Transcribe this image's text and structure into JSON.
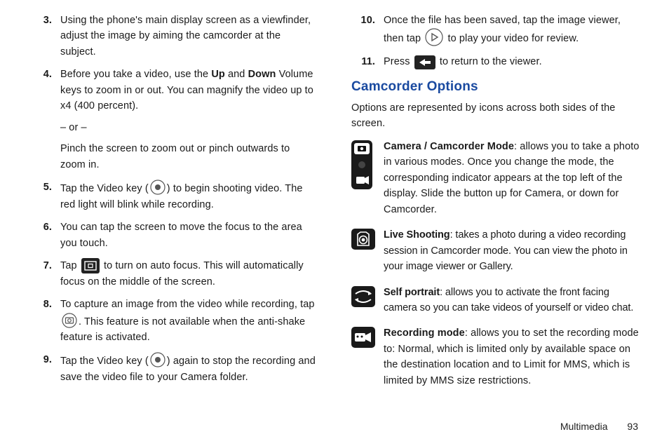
{
  "left": {
    "steps": [
      {
        "n": "3.",
        "text": "Using the phone's main display screen as a viewfinder, adjust the image by aiming the camcorder at the subject."
      },
      {
        "n": "4.",
        "pre": "Before you take a video, use the ",
        "b1": "Up",
        "mid1": " and ",
        "b2": "Down",
        "post1": " Volume keys to zoom in or out. You can magnify the video up to x4 (400 percent).",
        "sub1": "– or –",
        "sub2": "Pinch the screen to zoom out or pinch outwards to zoom in."
      },
      {
        "n": "5.",
        "pre": "Tap the Video key (",
        "post": ") to begin shooting video. The red light will blink while recording."
      },
      {
        "n": "6.",
        "text": "You can tap the screen to move the focus to the area you touch."
      },
      {
        "n": "7.",
        "pre": "Tap ",
        "post": " to turn on auto focus. This will automatically focus on the middle of the screen."
      },
      {
        "n": "8.",
        "pre": "To capture an image from the video while recording, tap ",
        "post": ". This feature is not available when the anti-shake feature is activated."
      },
      {
        "n": "9.",
        "pre": "Tap the Video key (",
        "post": ") again to stop the recording and save the video file to your Camera folder."
      }
    ]
  },
  "right": {
    "steps": [
      {
        "n": "10.",
        "pre": "Once the file has been saved, tap the image viewer, then tap ",
        "post": " to play your video for review."
      },
      {
        "n": "11.",
        "pre": "Press ",
        "post": " to return to the viewer."
      }
    ],
    "heading": "Camcorder Options",
    "intro": "Options are represented by icons across both sides of the screen.",
    "options": [
      {
        "title": "Camera / Camcorder Mode",
        "text": ": allows you to take a photo in various modes. Once you change the mode, the corresponding indicator appears at the top left of the display. Slide the button up for Camera, or down for Camcorder."
      },
      {
        "title": "Live Shooting",
        "text": ": takes a photo during a video recording session in Camcorder mode. You can view the photo in your image viewer or Gallery."
      },
      {
        "title": "Self portrait",
        "text": ": allows you to activate the front facing camera so you can take videos of yourself or video chat."
      },
      {
        "title": "Recording mode",
        "text": ": allows you to set the recording mode to: Normal, which is limited only by available space on the destination location and to Limit for MMS, which is limited by MMS size restrictions."
      }
    ]
  },
  "footer": {
    "section": "Multimedia",
    "page": "93"
  }
}
